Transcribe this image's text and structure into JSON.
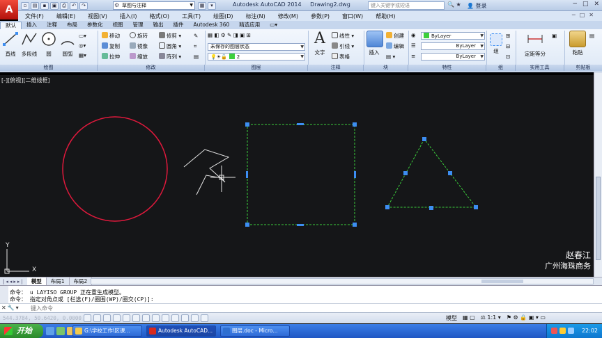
{
  "titlebar": {
    "app_title": "Autodesk AutoCAD 2014",
    "doc_name": "Drawing2.dwg",
    "workspace": "草图与注释",
    "search_placeholder": "键入关键字或短语",
    "login": "登录"
  },
  "menu": [
    "文件(F)",
    "编辑(E)",
    "视图(V)",
    "插入(I)",
    "格式(O)",
    "工具(T)",
    "绘图(D)",
    "标注(N)",
    "修改(M)",
    "参数(P)",
    "窗口(W)",
    "帮助(H)"
  ],
  "ribbon_tabs": [
    "默认",
    "插入",
    "注释",
    "布局",
    "参数化",
    "视图",
    "管理",
    "输出",
    "插件",
    "Autodesk 360",
    "精选应用"
  ],
  "ribbon": {
    "draw": {
      "line": "直线",
      "polyline": "多段线",
      "circle": "圆",
      "arc": "圆弧",
      "panel": "绘图"
    },
    "modify": {
      "move": "移动",
      "rotate": "旋转",
      "trim": "修剪",
      "copy": "复制",
      "mirror": "镜像",
      "fillet": "圆角",
      "stretch": "拉伸",
      "scale": "缩放",
      "array": "阵列",
      "panel": "修改"
    },
    "layer": {
      "state": "未保存的图层状态",
      "current": "2",
      "panel": "图层"
    },
    "annotation": {
      "text": "文字",
      "linear": "线性",
      "leader": "引线",
      "table": "表格",
      "panel": "注释"
    },
    "block": {
      "insert": "插入",
      "create": "创建",
      "edit": "编辑",
      "panel": "块"
    },
    "properties": {
      "color": "ByLayer",
      "linetype": "ByLayer",
      "lineweight": "ByLayer",
      "panel": "特性"
    },
    "group": {
      "group": "组",
      "panel": "组"
    },
    "utilities": {
      "measure": "定距等分",
      "panel": "实用工具"
    },
    "clipboard": {
      "paste": "粘贴",
      "panel": "剪贴板"
    }
  },
  "viewport": {
    "label": "[-][俯视][二维线框]",
    "watermark_line1": "赵春江",
    "watermark_line2": "广州海珠商务"
  },
  "layout_tabs": [
    "模型",
    "布局1",
    "布局2"
  ],
  "command": {
    "history": [
      "命令： u LAYISO GROUP 正在重生成模型。",
      "命令： 指定对角点或 [栏选(F)/圈围(WP)/圈交(CP)]:"
    ],
    "placeholder": "键入命令"
  },
  "status": {
    "coords": "544.3784, 50.6420, 0.0000",
    "model": "模型",
    "scale": "1:1",
    "time": "22:02"
  },
  "taskbar": {
    "start": "开始",
    "items": [
      "G:\\学校工作\\区课...",
      "Autodesk AutoCAD...",
      "图层.doc - Micro..."
    ]
  },
  "colors": {
    "circle": "#e0193c",
    "selected": "#3ccf3c",
    "grip": "#3d8ef2",
    "bg": "#151618"
  }
}
